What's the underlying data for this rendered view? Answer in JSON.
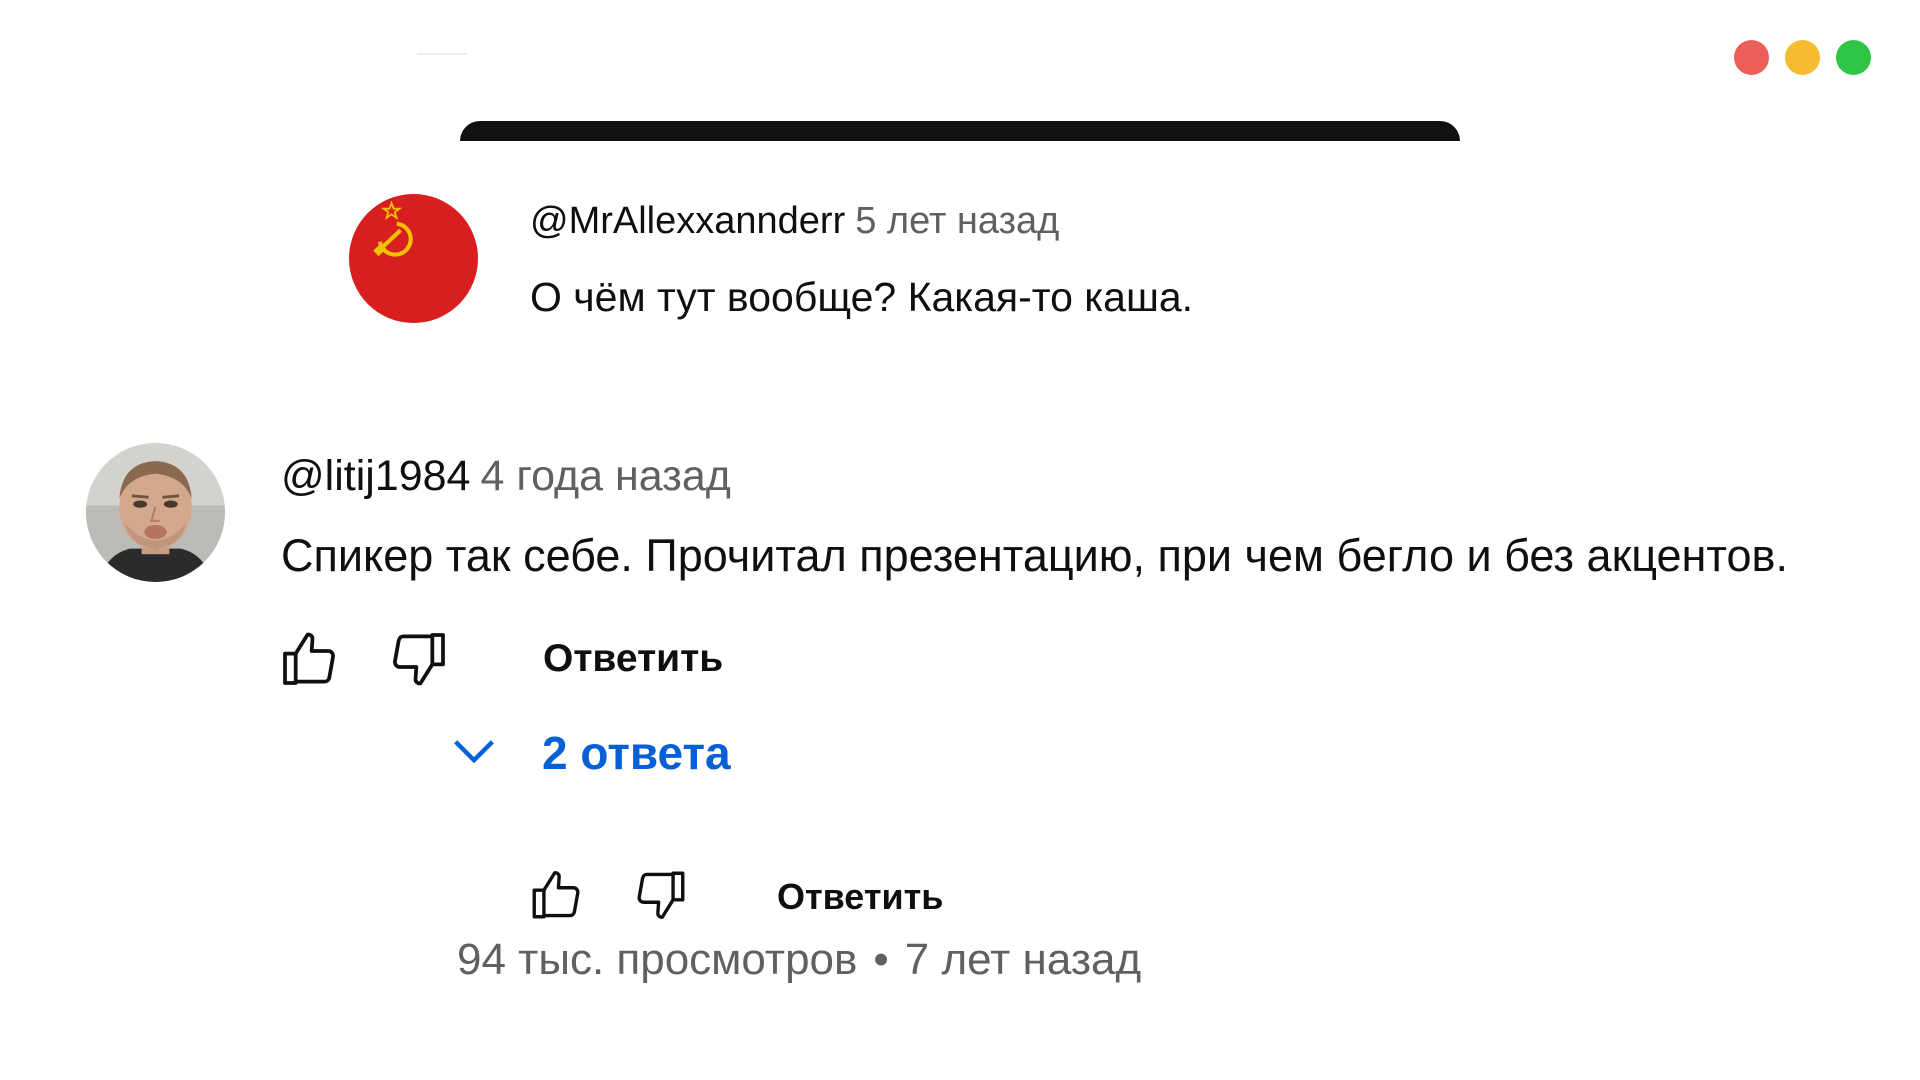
{
  "window_controls": {
    "close_color": "#ec5f58",
    "minimize_color": "#f5bc31",
    "maximize_color": "#31c548"
  },
  "comments": [
    {
      "author": "@MrAllexxannderr",
      "time": "5 лет назад",
      "text": "О чём тут вообще? Какая-то каша.",
      "avatar": "soviet-flag-avatar"
    },
    {
      "author": "@litij1984",
      "time": "4 года назад",
      "text": "Спикер так себе. Прочитал презентацию, при чем бегло и без акцентов.",
      "avatar": "user-photo-avatar",
      "actions": {
        "like_icon": "thumbs-up-icon",
        "dislike_icon": "thumbs-down-icon",
        "reply_label": "Ответить"
      },
      "replies_toggle": {
        "icon": "chevron-down-icon",
        "label": "2 ответа"
      }
    }
  ],
  "bottom_actions": {
    "like_icon": "thumbs-up-icon",
    "dislike_icon": "thumbs-down-icon",
    "reply_label": "Ответить"
  },
  "video_meta": {
    "views": "94 тыс. просмотров",
    "separator": "•",
    "age": "7 лет назад"
  },
  "colors": {
    "link_blue": "#065fd4",
    "secondary_text": "#606060",
    "soviet_red": "#cc0000"
  }
}
